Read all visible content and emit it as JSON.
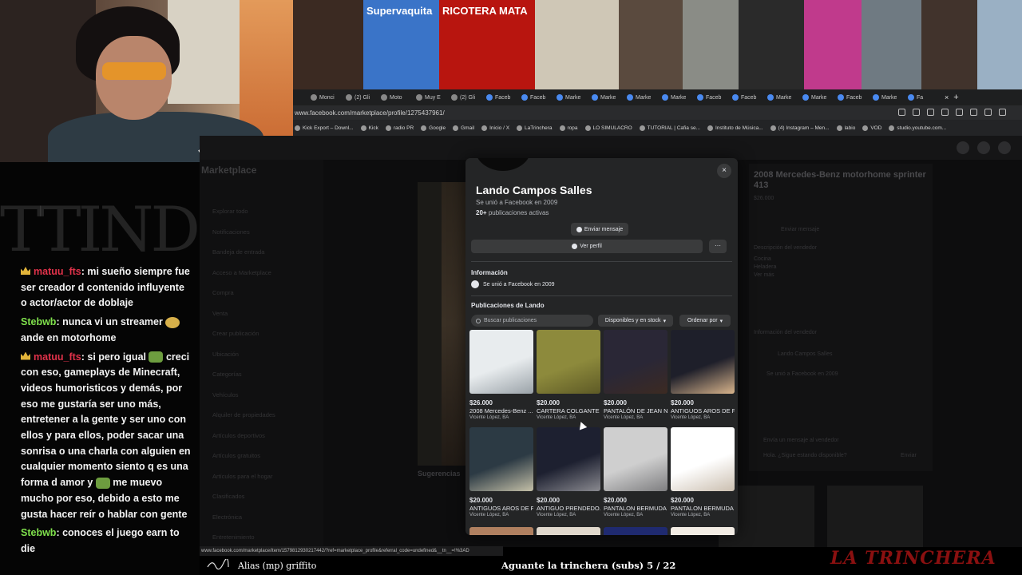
{
  "chat": {
    "graffiti": "TTINDIG",
    "messages": [
      {
        "user": "matuu_fts",
        "color": "red",
        "badge": true,
        "text": ": mi sueño siempre fue ser creador d contenido influyente o actor/actor de doblaje",
        "emote": ""
      },
      {
        "user": "Stebwb",
        "color": "green",
        "badge": false,
        "text": ": nunca vi un streamer",
        "emote": "yellow",
        "tail": " ande en motorhome"
      },
      {
        "user": "matuu_fts",
        "color": "red",
        "badge": true,
        "text": ": si pero igual",
        "emote": "green",
        "tail": " creci con eso, gameplays de Minecraft, videos humoristicos y demás, por eso me gustaría ser uno más, entretener a la gente y ser uno con ellos y para ellos, poder sacar una sonrisa o una charla con alguien en cualquier momento siento q es una forma d amor y",
        "emote2": "green",
        "tail2": " me muevo mucho por eso, debido a esto me gusta hacer reír o hablar con gente"
      },
      {
        "user": "Stebwb",
        "color": "green",
        "badge": false,
        "text": ": conoces el juego earn to die",
        "emote": ""
      }
    ]
  },
  "thumbs": [
    {
      "caption": "",
      "color": "#3b2a22"
    },
    {
      "caption": "Supervaquita",
      "color": "#3a74c8"
    },
    {
      "caption": "RICOTERA MATA",
      "color": "#b8150f"
    },
    {
      "caption": "",
      "color": "#cfc7b6"
    },
    {
      "caption": "",
      "color": "#5a4a3e"
    },
    {
      "caption": "",
      "color": "#8a8c86"
    },
    {
      "caption": "",
      "color": "#2a2a2a"
    },
    {
      "caption": "",
      "color": "#c03a8c"
    },
    {
      "caption": "",
      "color": "#6f7a82"
    },
    {
      "caption": "",
      "color": "#41332c"
    },
    {
      "caption": "",
      "color": "#9ab0c4"
    }
  ],
  "browser": {
    "tabs": [
      "Monci",
      "(2) Gli",
      "Moto",
      "Muy E",
      "(2) Gli",
      "Faceb",
      "Faceb",
      "Marke",
      "Marke",
      "Marke",
      "Marke",
      "Faceb",
      "Faceb",
      "Marke",
      "Marke",
      "Faceb",
      "Marke",
      "Fa"
    ],
    "url": "www.facebook.com/marketplace/profile/1275437961/",
    "bookmarks": [
      "Kick Export – Downl...",
      "Kick",
      "radio PR",
      "Google",
      "Gmail",
      "Inicio / X",
      "LaTrinchera",
      "ropa",
      "LO SIMULACRO",
      "TUTORIAL | Cafia se...",
      "Instituto de Música...",
      "(4) Instagram – Men...",
      "labio",
      "VOD",
      "studio.youtube.com..."
    ]
  },
  "fb_background": {
    "sidebar_title": "Marketplace",
    "sidebar_items": [
      "Explorar todo",
      "Notificaciones",
      "Bandeja de entrada",
      "Acceso a Marketplace",
      "Compra",
      "Venta",
      "Crear publicación",
      "Ubicación",
      "Categorías",
      "Vehículos",
      "Alquiler de propiedades",
      "Artículos deportivos",
      "Artículos gratuitos",
      "Artículos para el hogar",
      "Clasificados",
      "Electrónica",
      "Entretenimiento"
    ],
    "detail_title": "2008 Mercedes-Benz motorhome sprinter 413",
    "detail_price": "$26.000",
    "detail_lines": [
      "Enviar mensaje",
      "Descripción del vendedor",
      "Cocina",
      "Heladera",
      "Ver más",
      "Información del vendedor",
      "Lando Campos Salles",
      "Se unió a Facebook en 2009",
      "Envía un mensaje al vendedor",
      "Hola. ¿Sigue estando disponible?",
      "Enviar"
    ],
    "suggestions": "Sugerencias"
  },
  "modal": {
    "name": "Lando Campos Salles",
    "joined": "Se unió a Facebook en 2009",
    "listings_count": "20+",
    "listings_label": "publicaciones activas",
    "message_button": "Enviar mensaje",
    "profile_button": "Ver perfil",
    "more_button": "···",
    "close": "×",
    "info_title": "Información",
    "info_joined": "Se unió a Facebook en 2009",
    "listings_title": "Publicaciones de Lando",
    "search_placeholder": "Buscar publicaciones",
    "filter_stock": "Disponibles y en stock",
    "filter_sort": "Ordenar por",
    "items": [
      {
        "price": "$26.000",
        "title": "2008 Mercedes-Benz ...",
        "loc": "Vicente López, BA",
        "colors": [
          "#e8ecee",
          "#9aa2a8"
        ]
      },
      {
        "price": "$20.000",
        "title": "CARTERA COLGANTE ...",
        "loc": "Vicente López, BA",
        "colors": [
          "#8d8a3c",
          "#5e5a26"
        ]
      },
      {
        "price": "$20.000",
        "title": "PANTALÓN DE JEAN N...",
        "loc": "Vicente López, BA",
        "colors": [
          "#2a2736",
          "#3c2a22"
        ]
      },
      {
        "price": "$20.000",
        "title": "ANTIGUOS AROS DE F...",
        "loc": "Vicente López, BA",
        "colors": [
          "#1e1f2a",
          "#d8b48c"
        ]
      },
      {
        "price": "$20.000",
        "title": "ANTIGUOS AROS DE F...",
        "loc": "Vicente López, BA",
        "colors": [
          "#2c3a44",
          "#c4c0a8"
        ]
      },
      {
        "price": "$20.000",
        "title": "ANTIGUO PRENDEDO...",
        "loc": "Vicente López, BA",
        "colors": [
          "#1d2030",
          "#8a8a90"
        ]
      },
      {
        "price": "$20.000",
        "title": "PANTALON BERMUDA ...",
        "loc": "Vicente López, BA",
        "colors": [
          "#cfcfcf",
          "#7e7e80"
        ]
      },
      {
        "price": "$20.000",
        "title": "PANTALON BERMUDA ...",
        "loc": "Vicente López, BA",
        "colors": [
          "#ffffff",
          "#cbbfb0"
        ]
      }
    ]
  },
  "status_url": "www.facebook.com/marketplace/item/1579812930217442/?ref=marketplace_profile&referral_code=undefined&__tn__=!%3AD",
  "stream": {
    "song": "Alias (mp) griffito",
    "goal": "Aguante la trinchera (subs) 5 / 22",
    "watermark": "LA TRINCHERA"
  }
}
